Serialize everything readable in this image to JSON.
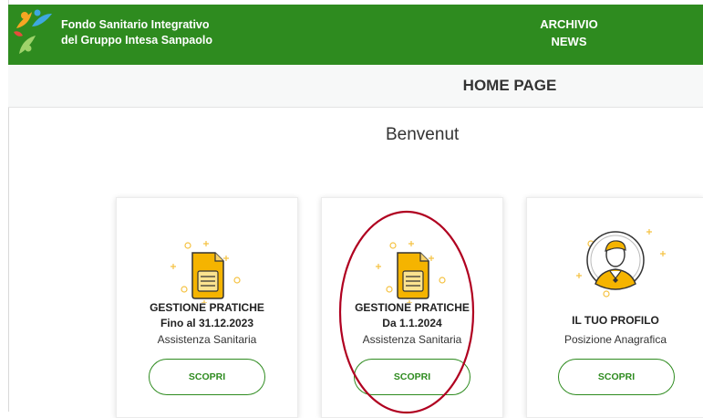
{
  "header": {
    "brand_line1": "Fondo Sanitario Integrativo",
    "brand_line2": "del Gruppo Intesa Sanpaolo",
    "nav": [
      "ARCHIVIO",
      "NEWS"
    ]
  },
  "subbar": {
    "title": "HOME PAGE"
  },
  "welcome": "Benvenut",
  "cards": [
    {
      "title": "GESTIONE PRATICHE",
      "subtitle": "Fino al 31.12.2023",
      "desc": "Assistenza Sanitaria",
      "button": "SCOPRI",
      "icon": "document-icon"
    },
    {
      "title": "GESTIONE PRATICHE",
      "subtitle": "Da 1.1.2024",
      "desc": "Assistenza Sanitaria",
      "button": "SCOPRI",
      "icon": "document-icon"
    },
    {
      "title": "",
      "subtitle": "IL TUO PROFILO",
      "desc": "Posizione Anagrafica",
      "button": "SCOPRI",
      "icon": "user-profile-icon"
    }
  ],
  "colors": {
    "brand_green": "#2e8b1f",
    "icon_yellow": "#f5b400",
    "annotation_red": "#b00020"
  }
}
